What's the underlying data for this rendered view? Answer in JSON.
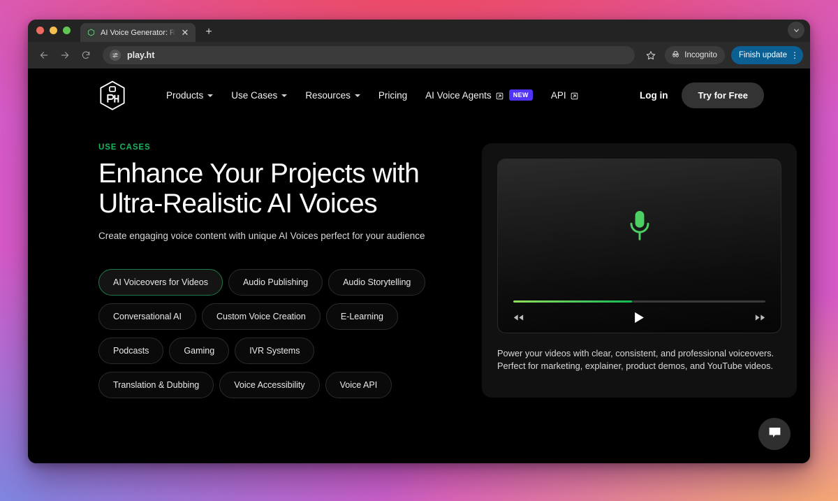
{
  "browser": {
    "tab": {
      "title": "AI Voice Generator: Realistic T",
      "favicon_icon": "playht-logo-icon",
      "close_icon": "close-icon"
    },
    "new_tab_label": "+",
    "tab_list_icon": "chevron-down-icon",
    "toolbar": {
      "back_icon": "back-arrow-icon",
      "forward_icon": "forward-arrow-icon",
      "reload_icon": "reload-icon",
      "site_settings_icon": "tune-icon",
      "url": "play.ht",
      "bookmark_icon": "star-icon",
      "incognito_label": "Incognito",
      "incognito_icon": "incognito-icon",
      "update_label": "Finish update",
      "menu_icon": "kebab-menu-icon"
    }
  },
  "site": {
    "logo_name": "playht-logo",
    "nav": [
      {
        "label": "Products",
        "has_caret": true,
        "external": false,
        "badge": null
      },
      {
        "label": "Use Cases",
        "has_caret": true,
        "external": false,
        "badge": null
      },
      {
        "label": "Resources",
        "has_caret": true,
        "external": false,
        "badge": null
      },
      {
        "label": "Pricing",
        "has_caret": false,
        "external": false,
        "badge": null
      },
      {
        "label": "AI Voice Agents",
        "has_caret": false,
        "external": true,
        "badge": "NEW"
      },
      {
        "label": "API",
        "has_caret": false,
        "external": true,
        "badge": null
      }
    ],
    "login_label": "Log in",
    "cta_label": "Try for Free"
  },
  "hero": {
    "eyebrow": "USE CASES",
    "title_line1": "Enhance Your Projects with",
    "title_line2": "Ultra-Realistic AI Voices",
    "subtitle": "Create engaging voice content with unique AI Voices perfect for your audience",
    "pills": [
      {
        "label": "AI Voiceovers for Videos",
        "active": true
      },
      {
        "label": "Audio Publishing",
        "active": false
      },
      {
        "label": "Audio Storytelling",
        "active": false
      },
      {
        "label": "Conversational AI",
        "active": false
      },
      {
        "label": "Custom Voice Creation",
        "active": false
      },
      {
        "label": "E-Learning",
        "active": false
      },
      {
        "label": "Podcasts",
        "active": false
      },
      {
        "label": "Gaming",
        "active": false
      },
      {
        "label": "IVR Systems",
        "active": false
      },
      {
        "label": "Translation & Dubbing",
        "active": false
      },
      {
        "label": "Voice Accessibility",
        "active": false
      },
      {
        "label": "Voice API",
        "active": false
      }
    ]
  },
  "player": {
    "visual_icon": "microphone-icon",
    "progress_percent": 47,
    "rewind_icon": "rewind-icon",
    "play_icon": "play-icon",
    "forward_icon": "fast-forward-icon",
    "caption": "Power your videos with clear, consistent, and professional voiceovers. Perfect for marketing, explainer, product demos, and YouTube videos."
  },
  "chat": {
    "icon": "chat-bubble-icon"
  },
  "colors": {
    "accent_green": "#19b65f",
    "badge_blue": "#4f34f5",
    "update_blue": "#0b5f93",
    "page_bg": "#000000"
  }
}
